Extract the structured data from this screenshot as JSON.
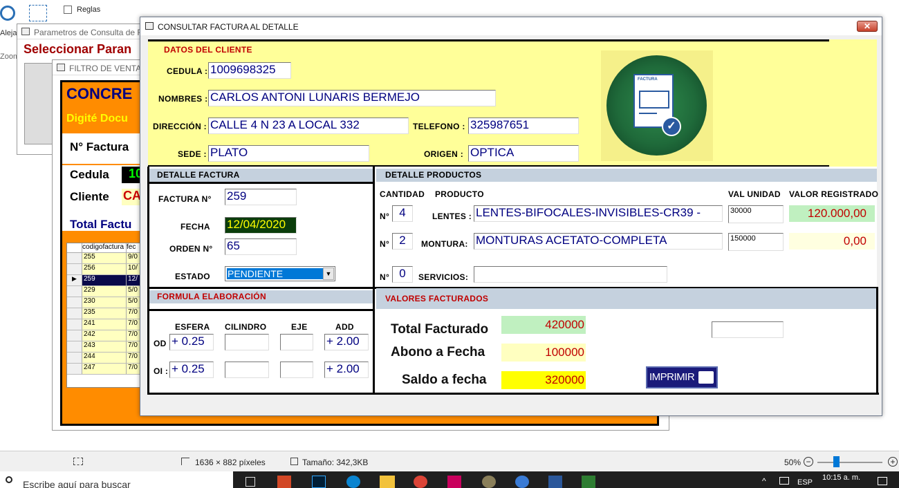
{
  "background": {
    "toolbar": {
      "reglas_label": "Reglas",
      "aleja_label": "Aleja",
      "zoom_label": "Zoom"
    },
    "window1": {
      "title": "Parametros de Consulta de Fa",
      "heading": "Seleccionar Paran"
    },
    "window2": {
      "title": "FILTRO DE VENTAS",
      "brand": "CONCRE",
      "prompt": "Digité Docu",
      "factura_label": "N° Factura",
      "cedula_label": "Cedula",
      "cedula_value": "10",
      "cliente_label": "Cliente",
      "cliente_value": "CA",
      "total_label": "Total Factu",
      "grid_headers": [
        "codigofactura",
        "fec"
      ],
      "grid_rows": [
        [
          "255",
          "9/0"
        ],
        [
          "256",
          "10/"
        ],
        [
          "259",
          "12/"
        ],
        [
          "229",
          "5/0"
        ],
        [
          "230",
          "5/0"
        ],
        [
          "235",
          "7/0"
        ],
        [
          "241",
          "7/0"
        ],
        [
          "242",
          "7/0"
        ],
        [
          "243",
          "7/0"
        ],
        [
          "244",
          "7/0"
        ],
        [
          "247",
          "7/0"
        ]
      ]
    }
  },
  "dialog": {
    "title": "CONSULTAR FACTURA AL DETALLE",
    "close": "✕",
    "cliente": {
      "header": "DATOS DEL CLIENTE",
      "cedula_label": "CEDULA :",
      "cedula": "1009698325",
      "nombres_label": "NOMBRES :",
      "nombres": "CARLOS ANTONI LUNARIS BERMEJO",
      "direccion_label": "DIRECCIÓN :",
      "direccion": "CALLE 4 N 23 A LOCAL 332",
      "telefono_label": "TELEFONO :",
      "telefono": "325987651",
      "sede_label": "SEDE :",
      "sede": "PLATO",
      "origen_label": "ORIGEN :",
      "origen": "OPTICA",
      "logo_text": "FACTURA"
    },
    "detalle_factura": {
      "header": "DETALLE FACTURA",
      "factura_label": "FACTURA  N°",
      "factura": "259",
      "fecha_label": "FECHA",
      "fecha": "12/04/2020",
      "orden_label": "ORDEN N°",
      "orden": "65",
      "estado_label": "ESTADO",
      "estado": "PENDIENTE"
    },
    "detalle_productos": {
      "header": "DETALLE PRODUCTOS",
      "col_cantidad": "CANTIDAD",
      "col_producto": "PRODUCTO",
      "col_val_unidad": "VAL UNIDAD",
      "col_valor_registrado": "VALOR REGISTRADO",
      "rows": [
        {
          "n_label": "N°",
          "cantidad": "4",
          "label": "LENTES :",
          "producto": "LENTES-BIFOCALES-INVISIBLES-CR39  -",
          "val_unidad": "30000",
          "valor": "120.000,00"
        },
        {
          "n_label": "N°",
          "cantidad": "2",
          "label": "MONTURA:",
          "producto": "MONTURAS  ACETATO-COMPLETA",
          "val_unidad": "150000",
          "valor": "0,00"
        },
        {
          "n_label": "N°",
          "cantidad": "0",
          "label": "SERVICIOS:",
          "producto": "",
          "val_unidad": "",
          "valor": ""
        }
      ]
    },
    "formula": {
      "header": "FORMULA ELABORACIÓN",
      "col_esfera": "ESFERA",
      "col_cilindro": "CILINDRO",
      "col_eje": "EJE",
      "col_add": "ADD",
      "od_label": "OD",
      "od_esfera": "+ 0.25",
      "od_cilindro": "",
      "od_eje": "",
      "od_add": "+  2.00",
      "oi_label": "OI :",
      "oi_esfera": "+ 0.25",
      "oi_cilindro": "",
      "oi_eje": "",
      "oi_add": "+  2.00"
    },
    "valores": {
      "header": "VALORES FACTURADOS",
      "total_label": "Total Facturado",
      "total": "420000",
      "abono_label": "Abono a Fecha",
      "abono": "100000",
      "saldo_label": "Saldo a fecha",
      "saldo": "320000",
      "imprimir": "IMPRIMIR"
    }
  },
  "statusbar": {
    "dimensions": "1636 × 882 píxeles",
    "size": "Tamaño: 342,3KB",
    "zoom": "50%"
  },
  "taskbar": {
    "search_placeholder": "Escribe aquí para buscar",
    "lang": "ESP",
    "time": "10:15 a. m."
  }
}
